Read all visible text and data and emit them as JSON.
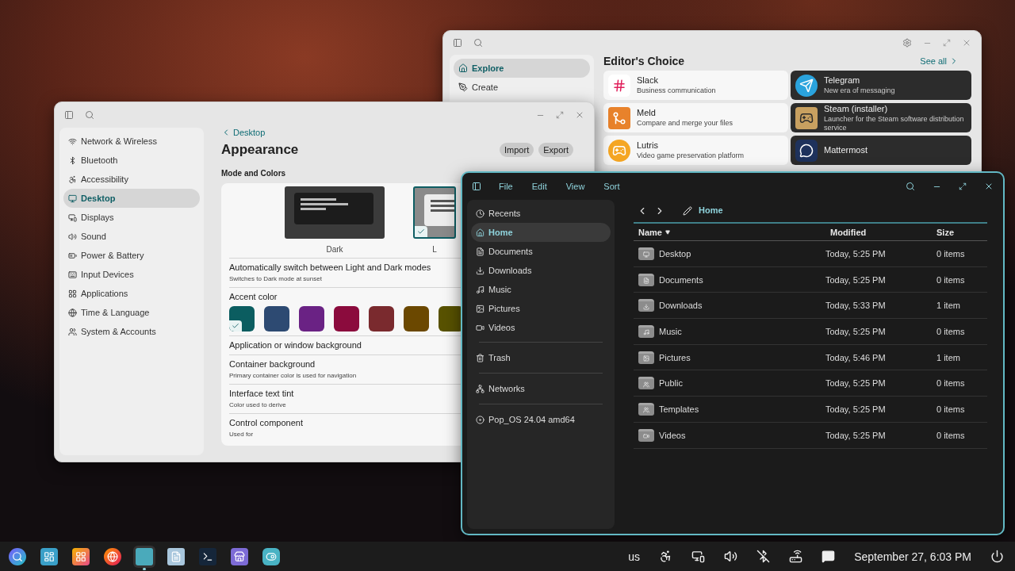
{
  "app_store": {
    "sidebar": [
      {
        "label": "Explore",
        "selected": true
      },
      {
        "label": "Create",
        "selected": false
      }
    ],
    "section_title": "Editor's Choice",
    "see_all": "See all",
    "apps": [
      {
        "name": "Slack",
        "description": "Business communication"
      },
      {
        "name": "Telegram",
        "description": "New era of messaging"
      },
      {
        "name": "Meld",
        "description": "Compare and merge your files"
      },
      {
        "name": "Steam (installer)",
        "description": "Launcher for the Steam software distribution service"
      },
      {
        "name": "Lutris",
        "description": "Video game preservation platform"
      },
      {
        "name": "Mattermost"
      }
    ]
  },
  "settings": {
    "sidebar": [
      {
        "label": "Network & Wireless",
        "selected": false
      },
      {
        "label": "Bluetooth",
        "selected": false
      },
      {
        "label": "Accessibility",
        "selected": false
      },
      {
        "label": "Desktop",
        "selected": true
      },
      {
        "label": "Displays",
        "selected": false
      },
      {
        "label": "Sound",
        "selected": false
      },
      {
        "label": "Power & Battery",
        "selected": false
      },
      {
        "label": "Input Devices",
        "selected": false
      },
      {
        "label": "Applications",
        "selected": false
      },
      {
        "label": "Time & Language",
        "selected": false
      },
      {
        "label": "System & Accounts",
        "selected": false
      }
    ],
    "back_link": "Desktop",
    "title": "Appearance",
    "buttons": [
      "Import",
      "Export"
    ],
    "section": "Mode and Colors",
    "themes": [
      {
        "label": "Dark",
        "kind": "dark",
        "selected": false
      },
      {
        "label": "L",
        "kind": "light",
        "selected": true
      }
    ],
    "auto_switch": {
      "title": "Automatically switch between Light and Dark modes",
      "description": "Switches to Dark mode at sunset"
    },
    "accent_label": "Accent color",
    "accents": [
      {
        "color": "#0b5d60",
        "selected": true
      },
      {
        "color": "#2d4a72",
        "selected": false
      },
      {
        "color": "#6a2284",
        "selected": false
      },
      {
        "color": "#8b0b3d",
        "selected": false
      },
      {
        "color": "#7a2a2e",
        "selected": false
      },
      {
        "color": "#6b4800",
        "selected": false
      },
      {
        "color": "#585200",
        "selected": false
      }
    ],
    "rows": [
      {
        "title": "Application or window background"
      },
      {
        "title": "Container background",
        "description": "Primary container color is used for navigation"
      },
      {
        "title": "Interface text tint",
        "description": "Color used to derive"
      },
      {
        "title": "Control component",
        "description": "Used for"
      }
    ]
  },
  "files": {
    "menu": [
      "File",
      "Edit",
      "View",
      "Sort"
    ],
    "sidebar": [
      {
        "label": "Recents",
        "selected": false,
        "kind": "place"
      },
      {
        "label": "Home",
        "selected": true,
        "kind": "place"
      },
      {
        "label": "Documents",
        "selected": false,
        "kind": "place"
      },
      {
        "label": "Downloads",
        "selected": false,
        "kind": "place"
      },
      {
        "label": "Music",
        "selected": false,
        "kind": "place"
      },
      {
        "label": "Pictures",
        "selected": false,
        "kind": "place"
      },
      {
        "label": "Videos",
        "selected": false,
        "kind": "place"
      },
      {
        "label": "Trash",
        "selected": false,
        "kind": "trash"
      },
      {
        "label": "Networks",
        "selected": false,
        "kind": "network"
      },
      {
        "label": "Pop_OS 24.04 amd64",
        "selected": false,
        "kind": "disc"
      }
    ],
    "breadcrumb": "Home",
    "columns": [
      "Name",
      "Modified",
      "Size"
    ],
    "rows": [
      {
        "name": "Desktop",
        "modified": "Today, 5:25 PM",
        "size": "0 items"
      },
      {
        "name": "Documents",
        "modified": "Today, 5:25 PM",
        "size": "0 items"
      },
      {
        "name": "Downloads",
        "modified": "Today, 5:33 PM",
        "size": "1 item"
      },
      {
        "name": "Music",
        "modified": "Today, 5:25 PM",
        "size": "0 items"
      },
      {
        "name": "Pictures",
        "modified": "Today, 5:46 PM",
        "size": "1 item"
      },
      {
        "name": "Public",
        "modified": "Today, 5:25 PM",
        "size": "0 items"
      },
      {
        "name": "Templates",
        "modified": "Today, 5:25 PM",
        "size": "0 items"
      },
      {
        "name": "Videos",
        "modified": "Today, 5:25 PM",
        "size": "0 items"
      }
    ]
  },
  "taskbar": {
    "apps": [
      {
        "active": false
      },
      {
        "active": false
      },
      {
        "active": false
      },
      {
        "active": false
      },
      {
        "active": true
      },
      {
        "active": false
      },
      {
        "active": false
      },
      {
        "active": false
      },
      {
        "active": false
      }
    ],
    "keyboard_layout": "us",
    "clock": "September 27, 6:03 PM"
  }
}
